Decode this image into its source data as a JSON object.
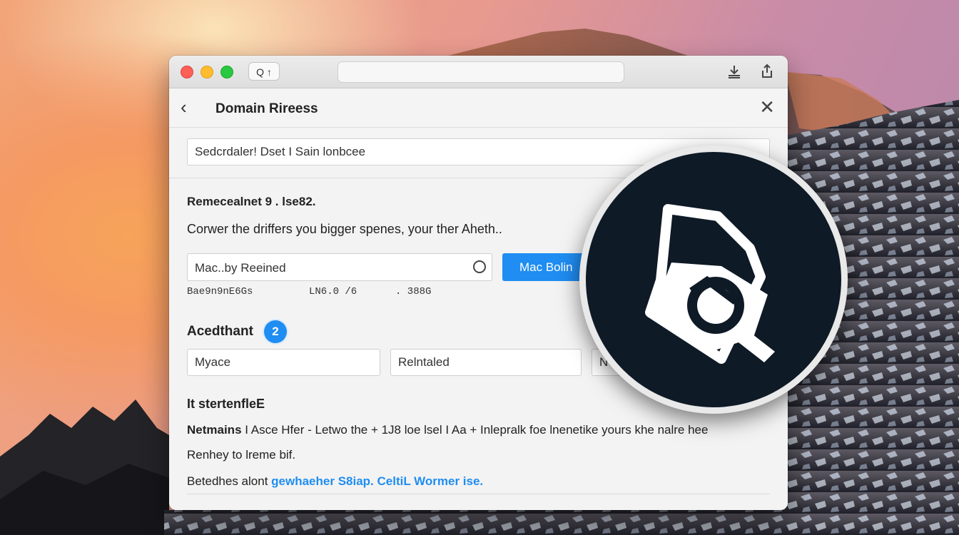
{
  "titlebar": {
    "tab_button_label": "Q ↑",
    "address_value": ""
  },
  "header": {
    "title": "Domain Rireess"
  },
  "search": {
    "value": "Sedcrdaler! Dset I Sain lonbcee"
  },
  "section1": {
    "title": "Remecealnet 9 . lse82.",
    "description": "Corwer the driffers you bigger spenes, your ther Aheth..",
    "input_value": "Mac..by Reeined",
    "button_label": "Mac Bolin",
    "stats": [
      "Bae9n9nE6Gs",
      "LN6.0 /6",
      ". 388G"
    ]
  },
  "section2": {
    "title": "Acedthant",
    "badge": "2",
    "fields": [
      "Myace",
      "Relntaled",
      "N"
    ]
  },
  "section3": {
    "title": "It stertenfleE",
    "line1_bold": "Netmains",
    "line1_rest": " I Asce Hfer - Letwo the + 1J8 loe lsel I Aa + Inlepralk foe lnenetike yours khe nalre hee",
    "line2": "Renhey to lreme bif.",
    "line3_text": "Betedhes alont ",
    "line3_link": "gewhaeher S8iap. CeltiL Wormer ise."
  },
  "colors": {
    "accent": "#1f8df2",
    "overlay_bg": "#0e1a26"
  },
  "icons": {
    "overlay": "tag-search-icon"
  }
}
